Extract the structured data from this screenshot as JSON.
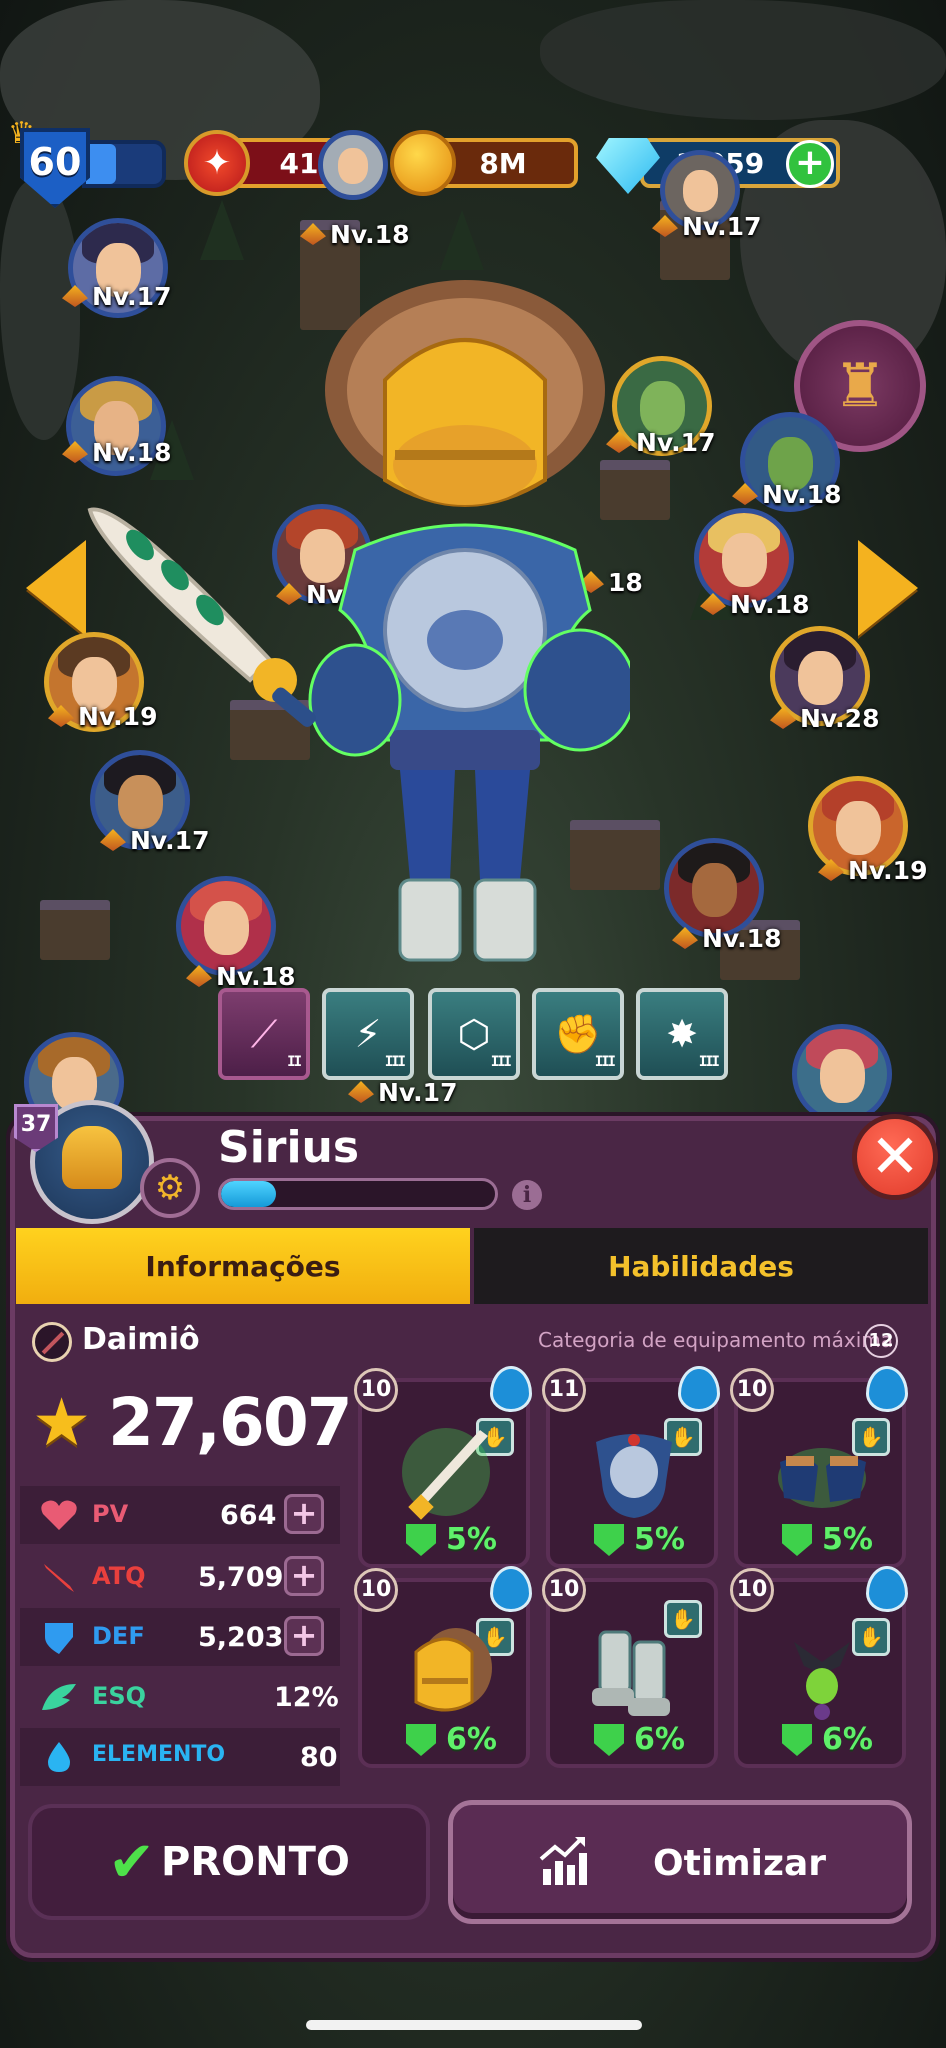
{
  "hud": {
    "player_level": "60",
    "energy": "41",
    "gold": "8M",
    "gems": "1,059",
    "add_gems_icon": "plus-icon"
  },
  "village_heroes": [
    {
      "level": "Nv.18"
    },
    {
      "level": "Nv.17"
    },
    {
      "level": "Nv.17"
    },
    {
      "level": "Nv.18"
    },
    {
      "level": "Nv.17"
    },
    {
      "level": "Nv.18"
    },
    {
      "level": "Nv.18"
    },
    {
      "level": "18"
    },
    {
      "level": "Nv.18"
    },
    {
      "level": "Nv.19"
    },
    {
      "level": "Nv.28"
    },
    {
      "level": "Nv.17"
    },
    {
      "level": "Nv.19"
    },
    {
      "level": "Nv.18"
    },
    {
      "level": "Nv.18"
    },
    {
      "level": "Nv.17"
    }
  ],
  "skills": [
    {
      "icon": "sword-icon",
      "pips": "II"
    },
    {
      "icon": "slash-icon",
      "pips": "III"
    },
    {
      "icon": "crest-icon",
      "pips": "III"
    },
    {
      "icon": "muscle-icon",
      "pips": "III"
    },
    {
      "icon": "burst-icon",
      "pips": "III"
    }
  ],
  "hero": {
    "level": "37",
    "name": "Sirius",
    "xp_progress": 0.2,
    "class_name": "Daimiô",
    "max_category_label": "Categoria de equipamento máxima",
    "max_category": "12",
    "power": "27,607"
  },
  "tabs": {
    "info": "Informações",
    "skills": "Habilidades"
  },
  "stats": [
    {
      "label": "PV",
      "value": "664",
      "color": "#e95b74",
      "upgrade": true
    },
    {
      "label": "ATQ",
      "value": "5,709",
      "color": "#e9403d",
      "upgrade": true
    },
    {
      "label": "DEF",
      "value": "5,203",
      "color": "#2f9bf0",
      "upgrade": true
    },
    {
      "label": "ESQ",
      "value": "12%",
      "color": "#3ad39e",
      "upgrade": false
    },
    {
      "label": "ELEMENTO",
      "value": "80",
      "color": "#2ab4f2",
      "upgrade": false
    }
  ],
  "equipment": [
    {
      "level": "10",
      "bonus": "5%",
      "item": "sword"
    },
    {
      "level": "11",
      "bonus": "5%",
      "item": "armor"
    },
    {
      "level": "10",
      "bonus": "5%",
      "item": "gauntlets"
    },
    {
      "level": "10",
      "bonus": "6%",
      "item": "helmet"
    },
    {
      "level": "10",
      "bonus": "6%",
      "item": "boots"
    },
    {
      "level": "10",
      "bonus": "6%",
      "item": "amulet"
    }
  ],
  "buttons": {
    "ready": "PRONTO",
    "optimize": "Otimizar"
  },
  "colors": {
    "panel": "#4a2645",
    "tab_active": "#ffd21e",
    "accent_gold": "#f4b21f",
    "bonus_green": "#5ff06a"
  }
}
